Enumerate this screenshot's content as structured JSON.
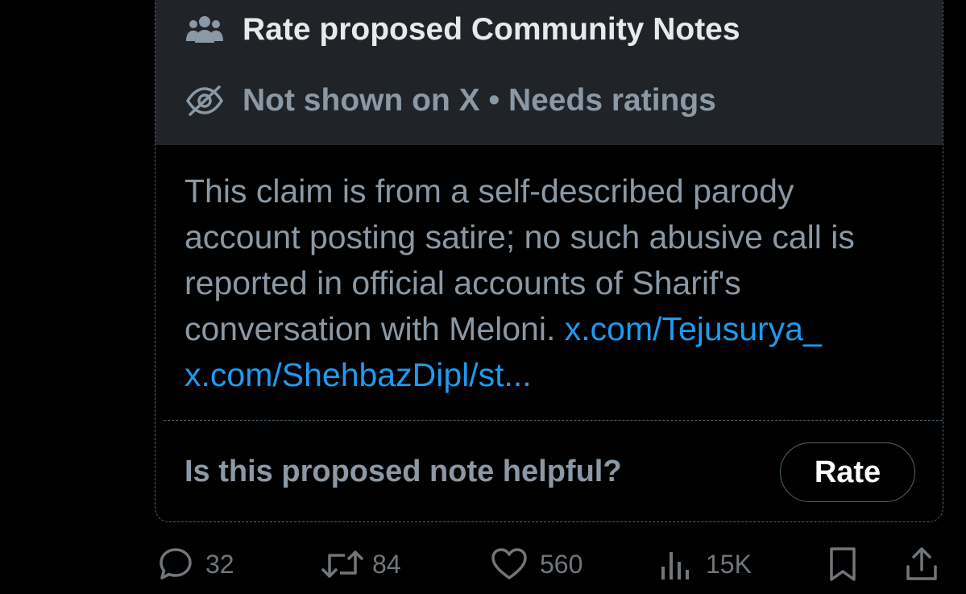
{
  "note": {
    "title": "Rate proposed Community Notes",
    "status": "Not shown on X • Needs ratings",
    "body_text": "This claim is from a self-described parody account posting satire; no such abusive call is reported in official accounts of Sharif's conversation with Meloni.",
    "link1": "x.com/Tejusurya_",
    "link2": "x.com/ShehbazDipl/st...",
    "question": "Is this proposed note helpful?",
    "rate_label": "Rate"
  },
  "actions": {
    "replies": "32",
    "reposts": "84",
    "likes": "560",
    "views": "15K"
  },
  "icons": {
    "header": "people-icon",
    "status": "eye-off-icon",
    "replies": "reply-icon",
    "reposts": "repost-icon",
    "likes": "heart-icon",
    "views": "views-icon",
    "bookmark": "bookmark-icon",
    "share": "share-icon"
  },
  "colors": {
    "background": "#000000",
    "header_bg": "#202327",
    "text_primary": "#e7e9ea",
    "text_secondary": "#8b98a5",
    "link": "#1d9bf0"
  }
}
